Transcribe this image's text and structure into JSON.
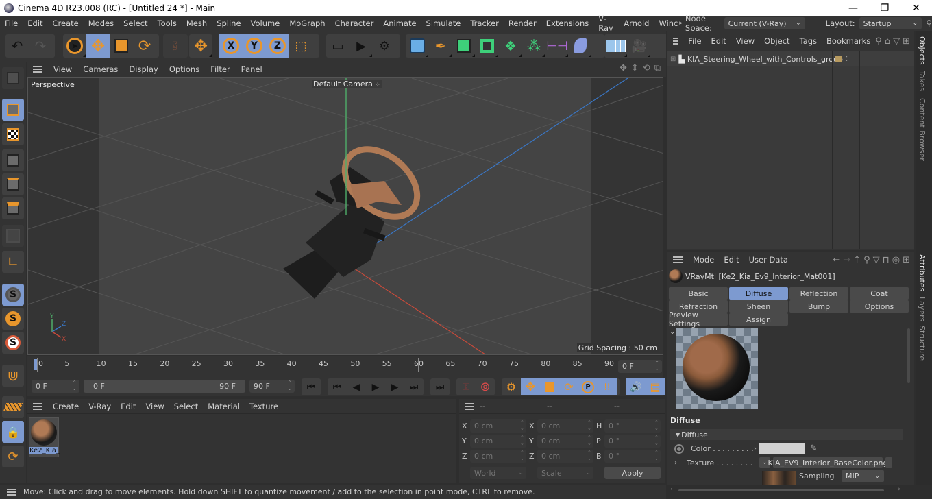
{
  "titlebar": {
    "title": "Cinema 4D R23.008 (RC) - [Untitled 24 *] - Main",
    "minimize": "—",
    "maximize": "❐",
    "close": "✕"
  },
  "menubar": {
    "items": [
      "File",
      "Edit",
      "Create",
      "Modes",
      "Select",
      "Tools",
      "Mesh",
      "Spline",
      "Volume",
      "MoGraph",
      "Character",
      "Animate",
      "Simulate",
      "Tracker",
      "Render",
      "Extensions",
      "V-Ray",
      "Arnold",
      "Winc"
    ],
    "more_arrow": "▸",
    "node_space_label": "Node Space:",
    "node_space_value": "Current (V-Ray)",
    "layout_label": "Layout:",
    "layout_value": "Startup"
  },
  "toolbar": {
    "axis_x": "X",
    "axis_y": "Y",
    "axis_z": "Z",
    "psr": "PSR"
  },
  "viewport": {
    "menu": [
      "View",
      "Cameras",
      "Display",
      "Options",
      "Filter",
      "Panel"
    ],
    "view_name": "Perspective",
    "camera_label": "Default Camera",
    "grid_spacing": "Grid Spacing : 50 cm",
    "axis_labels": {
      "x": "X",
      "y": "Y",
      "z": "Z"
    }
  },
  "timeline": {
    "ticks": [
      "0",
      "5",
      "10",
      "15",
      "20",
      "25",
      "30",
      "35",
      "40",
      "45",
      "50",
      "55",
      "60",
      "65",
      "70",
      "75",
      "80",
      "85",
      "90"
    ],
    "current_frame": "0 F"
  },
  "transport": {
    "start_field": "0 F",
    "range_start": "0 F",
    "range_end": "90 F",
    "end_field": "90 F"
  },
  "material_manager": {
    "menu": [
      "Create",
      "V-Ray",
      "Edit",
      "View",
      "Select",
      "Material",
      "Texture"
    ],
    "materials": [
      {
        "name": "Ke2_Kia_"
      }
    ]
  },
  "coordinates": {
    "headers": [
      "--",
      "--",
      "--"
    ],
    "rows": [
      {
        "pos_label": "X",
        "pos": "0 cm",
        "size_label": "X",
        "size": "0 cm",
        "rot_label": "H",
        "rot": "0 °"
      },
      {
        "pos_label": "Y",
        "pos": "0 cm",
        "size_label": "Y",
        "size": "0 cm",
        "rot_label": "P",
        "rot": "0 °"
      },
      {
        "pos_label": "Z",
        "pos": "0 cm",
        "size_label": "Z",
        "size": "0 cm",
        "rot_label": "B",
        "rot": "0 °"
      }
    ],
    "space_select": "World",
    "mode_select": "Scale",
    "apply": "Apply"
  },
  "objects": {
    "menu": [
      "File",
      "Edit",
      "View",
      "Object",
      "Tags",
      "Bookmarks"
    ],
    "items": [
      {
        "name": "KIA_Steering_Wheel_with_Controls_group"
      }
    ]
  },
  "attributes": {
    "menu": [
      "Mode",
      "Edit",
      "User Data"
    ],
    "material_title": "VRayMtl [Ke2_Kia_Ev9_Interior_Mat001]",
    "tabs": [
      [
        "Basic",
        "Diffuse",
        "Reflection",
        "Coat"
      ],
      [
        "Refraction",
        "Sheen",
        "Bump",
        "Options"
      ],
      [
        "Preview Settings",
        "Assign"
      ]
    ],
    "active_tab": "Diffuse",
    "section_title": "Diffuse",
    "group_title": "Diffuse",
    "color_label": "Color . . . . . . . . .",
    "color_value": "#d0d0d0",
    "texture_label": "Texture . . . . . . . .",
    "texture_file": "KIA_EV9_Interior_BaseColor.png",
    "sampling_label": "Sampling",
    "sampling_value": "MIP"
  },
  "side_tabs": {
    "top": [
      "Objects",
      "Takes",
      "Content Browser"
    ],
    "bottom": [
      "Attributes",
      "Layers",
      "Structure"
    ]
  },
  "status": {
    "text": "Move: Click and drag to move elements. Hold down SHIFT to quantize movement / add to the selection in point mode, CTRL to remove."
  },
  "colors": {
    "accent": "#7d9ad0",
    "orange": "#e8962c",
    "bg": "#333333"
  }
}
